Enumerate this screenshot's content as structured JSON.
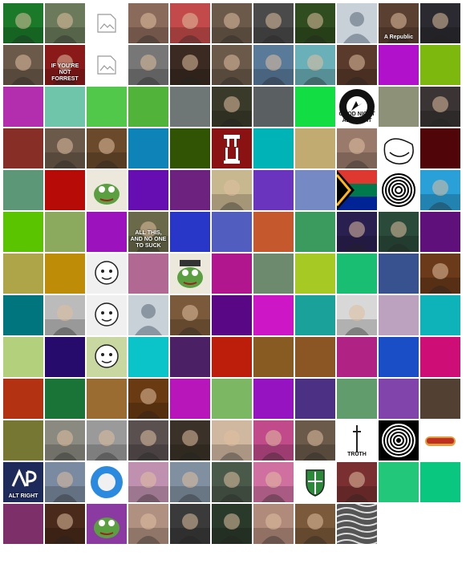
{
  "grid": {
    "rows": [
      [
        "flag-photo",
        "hand-photo",
        "broken",
        "sunglasses-photo",
        "red-hat-photo",
        "man-photo",
        "robot-photo",
        "flower-photo",
        "default-avatar",
        "painting-a-republic",
        "dark-animal-photo"
      ],
      [
        "man-photo",
        "confederate-meme-forrest",
        "broken",
        "man-portrait-bw",
        "masked-man-photo",
        "man-photo",
        "red-shirt-photo",
        "anime-girl-photo",
        "person-photo",
        "#B111CB",
        "#7DB80F"
      ],
      [
        "#B22EAE",
        "#6FC5AA",
        "#52C84A",
        "#52B33A",
        "#6E7776",
        "grim-reaper-photo",
        "#5A6062",
        "#12DD42",
        "alt-right-badge",
        "#8D9177",
        "robot-helmet-photo"
      ],
      [
        "#872F27",
        "man-photo",
        "man-portrait-painting",
        "#0E83B8",
        "#315404",
        "iu-logo",
        "#00B3B6",
        "#C1AB70",
        "old-man-painting",
        "trollface",
        "#500509"
      ],
      [
        "#5C9878",
        "#B60B06",
        "pepe-frog",
        "#670EB2",
        "#6D227F",
        "map-photo",
        "#6A34BF",
        "#7589C4",
        "south-africa-flag",
        "black-vortex",
        "man-sunglasses-photo"
      ],
      [
        "#5BC400",
        "#8CAA5D",
        "#9C13BD",
        "soldier-meme",
        "#2937C8",
        "#525EBF",
        "#C6582E",
        "#3B9A5D",
        "dark-figure-photo",
        "green-man-art",
        "#5F107A"
      ],
      [
        "#AEA549",
        "#BF8C07",
        "cartoon-boy",
        "#B16994",
        "pepe-officer",
        "#B1168E",
        "#6D8A6F",
        "#A7C924",
        "#19BE73",
        "#38518F",
        "food-photo"
      ],
      [
        "#00757D",
        "couple-reading",
        "cartoon-pair",
        "default-avatar",
        "blurred-painting",
        "#5A0786",
        "#CD16C5",
        "#1AA199",
        "baseball-card",
        "#BCA2BF",
        "#0EB3BA"
      ],
      [
        "#B3D07D",
        "#260A6C",
        "cartoon-beanie",
        "#0BC4CA",
        "#4B2065",
        "#BD1E0B",
        "#875B22",
        "#8B5624",
        "#B02384",
        "#1A4EC6",
        "#CF0D77"
      ],
      [
        "#B33212",
        "#1A7437",
        "#9A6C31",
        "dark-warrior-art",
        "#B815BB",
        "#7CB863",
        "#9613C1",
        "#4B3084",
        "#609C6C",
        "#8144AA",
        "#524033"
      ],
      [
        "#777734",
        "pale-figure-photo",
        "marble-statue",
        "sunglasses-man-photo",
        "skull-art",
        "blonde-man-photo",
        "pink-woman-photo",
        "man-photo",
        "truth-sword",
        "black-white-sun",
        "hot-dog"
      ],
      [
        "alt-right-logo",
        "field-photo",
        "rude-dog-logo",
        "pink-man-photo",
        "man-suit-photo",
        "catfish-photo",
        "pink-figure-photo",
        "knight-shield",
        "crowd-flags-photo",
        "#23C77A",
        "#09C77F"
      ],
      [
        "#7C2F68",
        "face-photo",
        "pepe-clown",
        "woman-photo",
        "gorilla-red-hat",
        "parliament-photo",
        "woman-face-photo",
        "fox-man-photo",
        "pattern-bw"
      ]
    ],
    "captions": {
      "confederate-meme-forrest": "IF YOU'RE NOT FORREST",
      "soldier-meme": "ALL THIS, AND NO ONE TO SUCK",
      "painting-a-republic": "A Republic",
      "truth-sword": "TRUTH",
      "alt-right-logo": "ALT RIGHT",
      "alt-right-badge": "GOOD NIGHT ALT-RIGHT"
    }
  }
}
